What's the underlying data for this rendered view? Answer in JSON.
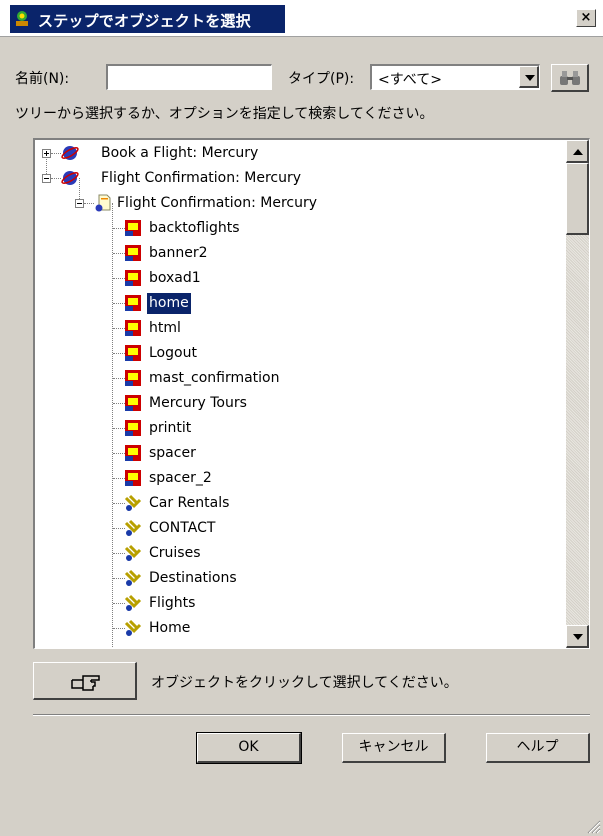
{
  "window": {
    "title": "ステップでオブジェクトを選択",
    "close_label": "×"
  },
  "search": {
    "name_label": "名前(N):",
    "name_value": "",
    "type_label": "タイプ(P):",
    "type_value": "<すべて>",
    "find_icon": "binoculars-icon"
  },
  "instruction": "ツリーから選択するか、オプションを指定して検索してください。",
  "tree": {
    "items": [
      {
        "label": "Book a Flight: Mercury",
        "icon": "browser-icon",
        "expander": "plus"
      },
      {
        "label": "Flight Confirmation: Mercury",
        "icon": "browser-icon",
        "expander": "minus"
      },
      {
        "label": "Flight Confirmation: Mercury",
        "icon": "page-icon",
        "expander": "minus"
      },
      {
        "label": "backtoflights",
        "icon": "image-icon"
      },
      {
        "label": "banner2",
        "icon": "image-icon"
      },
      {
        "label": "boxad1",
        "icon": "image-icon"
      },
      {
        "label": "home",
        "icon": "image-icon",
        "selected": true
      },
      {
        "label": "html",
        "icon": "image-icon"
      },
      {
        "label": "Logout",
        "icon": "image-icon"
      },
      {
        "label": "mast_confirmation",
        "icon": "image-icon"
      },
      {
        "label": "Mercury Tours",
        "icon": "image-icon"
      },
      {
        "label": "printit",
        "icon": "image-icon"
      },
      {
        "label": "spacer",
        "icon": "image-icon"
      },
      {
        "label": "spacer_2",
        "icon": "image-icon"
      },
      {
        "label": "Car Rentals",
        "icon": "link-icon"
      },
      {
        "label": "CONTACT",
        "icon": "link-icon"
      },
      {
        "label": "Cruises",
        "icon": "link-icon"
      },
      {
        "label": "Destinations",
        "icon": "link-icon"
      },
      {
        "label": "Flights",
        "icon": "link-icon"
      },
      {
        "label": "Home",
        "icon": "link-icon"
      }
    ]
  },
  "pick": {
    "icon": "pointing-hand-icon",
    "hint": "オブジェクトをクリックして選択してください。"
  },
  "buttons": {
    "ok": "OK",
    "cancel": "キャンセル",
    "help": "ヘルプ"
  },
  "colors": {
    "selection": "#0a246a",
    "face": "#d4d0c8"
  }
}
